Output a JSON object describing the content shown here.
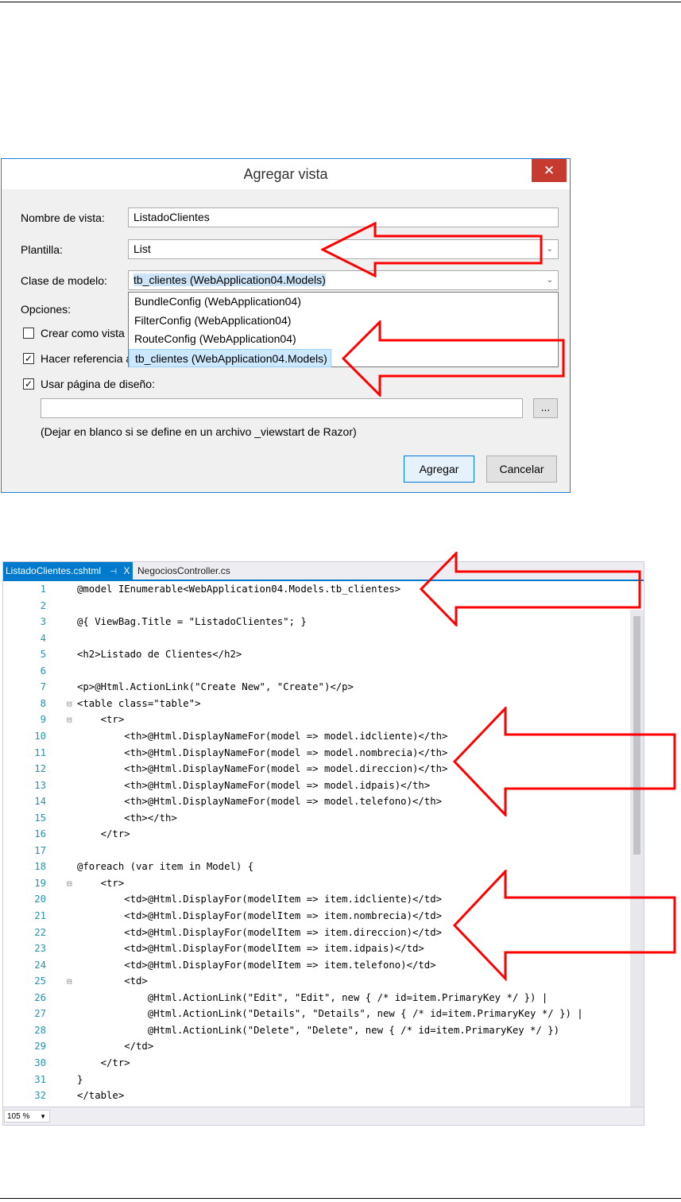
{
  "dialog": {
    "title": "Agregar vista",
    "close_glyph": "✕",
    "view_name_label": "Nombre de vista:",
    "view_name_value": "ListadoClientes",
    "template_label": "Plantilla:",
    "template_value": "List",
    "model_class_label": "Clase de modelo:",
    "model_class_value": "tb_clientes (WebApplication04.Models)",
    "options_label": "Opciones:",
    "model_class_options": [
      "BundleConfig (WebApplication04)",
      "FilterConfig (WebApplication04)",
      "RouteConfig (WebApplication04)",
      "tb_clientes (WebApplication04.Models)"
    ],
    "selected_option_index": 3,
    "checkbox_partial": {
      "label": "Crear como vista",
      "checked": false
    },
    "checkbox_reference": {
      "label": "Hacer referencia a",
      "checked": true
    },
    "checkbox_layout": {
      "label": "Usar página de diseño:",
      "checked": true
    },
    "layout_path_value": "",
    "browse_label": "...",
    "layout_hint": "(Dejar en blanco si se define en un archivo _viewstart de Razor)",
    "add_button": "Agregar",
    "cancel_button": "Cancelar"
  },
  "editor": {
    "active_tab": "ListadoClientes.cshtml",
    "active_tab_pin": "⊣",
    "active_tab_close": "X",
    "inactive_tab": "NegociosController.cs",
    "zoom": "105 %",
    "line_numbers": [
      "1",
      "2",
      "3",
      "4",
      "5",
      "6",
      "7",
      "8",
      "9",
      "10",
      "11",
      "12",
      "13",
      "14",
      "15",
      "16",
      "17",
      "18",
      "19",
      "20",
      "21",
      "22",
      "23",
      "24",
      "25",
      "26",
      "27",
      "28",
      "29",
      "30",
      "31",
      "32"
    ],
    "code_lines": [
      "@model IEnumerable<WebApplication04.Models.tb_clientes>",
      "",
      "@{ ViewBag.Title = \"ListadoClientes\"; }",
      "",
      "<h2>Listado de Clientes</h2>",
      "",
      "<p>@Html.ActionLink(\"Create New\", \"Create\")</p>",
      "<table class=\"table\">",
      "    <tr>",
      "        <th>@Html.DisplayNameFor(model => model.idcliente)</th>",
      "        <th>@Html.DisplayNameFor(model => model.nombrecia)</th>",
      "        <th>@Html.DisplayNameFor(model => model.direccion)</th>",
      "        <th>@Html.DisplayNameFor(model => model.idpais)</th>",
      "        <th>@Html.DisplayNameFor(model => model.telefono)</th>",
      "        <th></th>",
      "    </tr>",
      "",
      "@foreach (var item in Model) {",
      "    <tr>",
      "        <td>@Html.DisplayFor(modelItem => item.idcliente)</td>",
      "        <td>@Html.DisplayFor(modelItem => item.nombrecia)</td>",
      "        <td>@Html.DisplayFor(modelItem => item.direccion)</td>",
      "        <td>@Html.DisplayFor(modelItem => item.idpais)</td>",
      "        <td>@Html.DisplayFor(modelItem => item.telefono)</td>",
      "        <td>",
      "            @Html.ActionLink(\"Edit\", \"Edit\", new { /* id=item.PrimaryKey */ }) |",
      "            @Html.ActionLink(\"Details\", \"Details\", new { /* id=item.PrimaryKey */ }) |",
      "            @Html.ActionLink(\"Delete\", \"Delete\", new { /* id=item.PrimaryKey */ })",
      "        </td>",
      "    </tr>",
      "}",
      "</table>"
    ]
  },
  "colors": {
    "highlight_arrow": "#ff0000",
    "tab_accent": "#007acc",
    "line_number": "#2b91af",
    "razor_marker": "#ffff00"
  }
}
